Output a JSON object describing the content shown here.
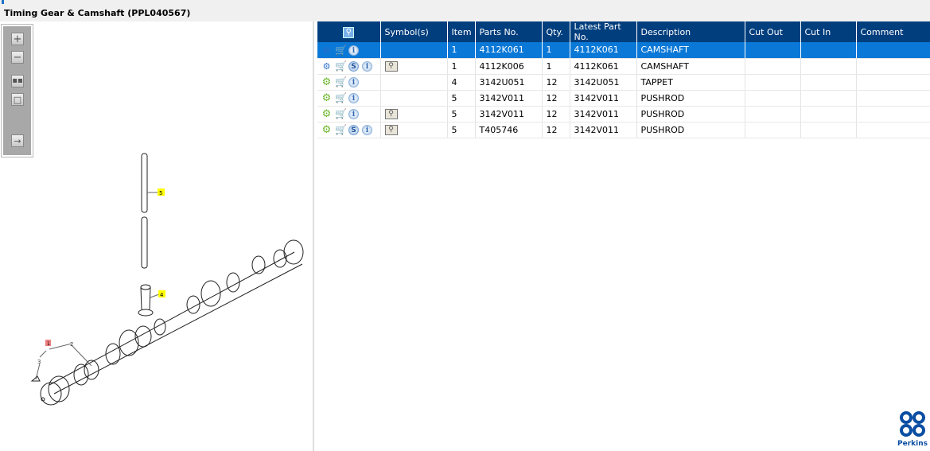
{
  "title": "Timing Gear & Camshaft (PPL040567)",
  "toolbar": {
    "zoom_in": "zoom-in",
    "zoom_out": "zoom-out",
    "fit": "fit",
    "actual": "actual",
    "toggle": "toggle-panel"
  },
  "drawing_labels": {
    "l1": "1",
    "l2": "2",
    "l3": "3",
    "l4": "4",
    "l5": "5"
  },
  "table": {
    "headers": {
      "symbols": "Symbol(s)",
      "item": "Item",
      "parts_no": "Parts No.",
      "qty": "Qty.",
      "latest": "Latest Part No.",
      "description": "Description",
      "cut_out": "Cut Out",
      "cut_in": "Cut In",
      "comment": "Comment"
    },
    "rows": [
      {
        "item": "1",
        "parts_no": "4112K061",
        "qty": "1",
        "latest": "4112K061",
        "description": "CAMSHAFT",
        "selected": true
      },
      {
        "item": "1",
        "parts_no": "4112K006",
        "qty": "1",
        "latest": "4112K061",
        "description": "CAMSHAFT"
      },
      {
        "item": "4",
        "parts_no": "3142U051",
        "qty": "12",
        "latest": "3142U051",
        "description": "TAPPET"
      },
      {
        "item": "5",
        "parts_no": "3142V011",
        "qty": "12",
        "latest": "3142V011",
        "description": "PUSHROD"
      },
      {
        "item": "5",
        "parts_no": "3142V011",
        "qty": "12",
        "latest": "3142V011",
        "description": "PUSHROD"
      },
      {
        "item": "5",
        "parts_no": "T405746",
        "qty": "12",
        "latest": "3142V011",
        "description": "PUSHROD"
      }
    ]
  },
  "logo": {
    "text": "Perkins"
  },
  "colors": {
    "header": "#003e7e",
    "selected": "#0a78d7"
  }
}
